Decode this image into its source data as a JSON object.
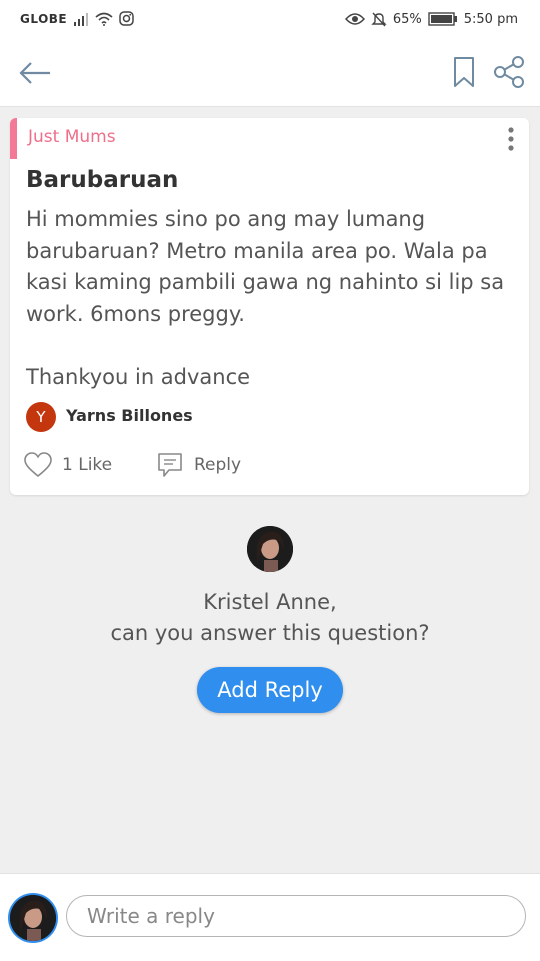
{
  "status_bar": {
    "carrier": "GLOBE",
    "battery": "65%",
    "time": "5:50 pm",
    "icons": [
      "signal-icon",
      "wifi-icon",
      "instagram-icon",
      "eye-icon",
      "mute-icon",
      "battery-icon"
    ]
  },
  "app_bar": {
    "icons": [
      "back-arrow-icon",
      "bookmark-icon",
      "share-icon"
    ]
  },
  "post": {
    "group": "Just Mums",
    "title": "Barubaruan",
    "body": "Hi mommies sino po ang may lumang barubaruan? Metro manila area po. Wala pa kasi kaming pambili gawa ng nahinto si lip sa work. 6mons preggy.\n\nThankyou in advance",
    "author": {
      "initial": "Y",
      "name": "Yarns Billones"
    },
    "like_label": "1 Like",
    "reply_label": "Reply"
  },
  "answer_prompt": {
    "user_name": "Kristel Anne,",
    "question": "can you answer this question?",
    "button": "Add Reply"
  },
  "composer": {
    "placeholder": "Write a reply"
  },
  "colors": {
    "accent_pink": "#f37a97",
    "group_text": "#ee6f8a",
    "primary_blue": "#2f8eee",
    "author_avatar": "#c4370e"
  }
}
